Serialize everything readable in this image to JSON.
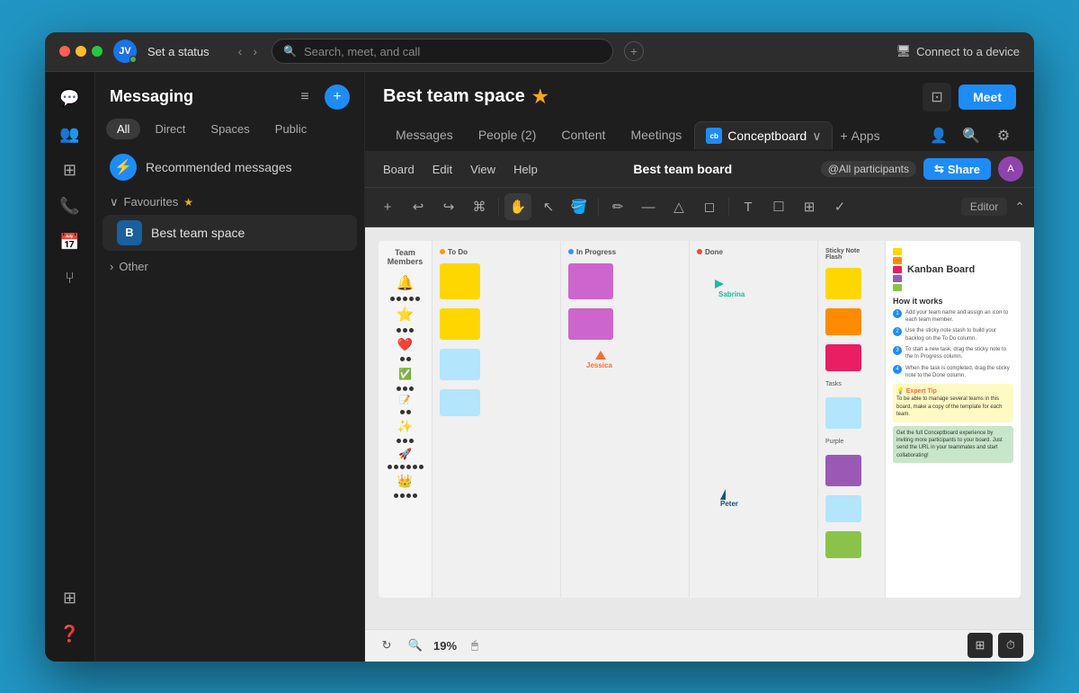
{
  "window": {
    "title": "Best team space"
  },
  "titlebar": {
    "user_initials": "JV",
    "set_status": "Set a status",
    "search_placeholder": "Search, meet, and call",
    "connect_device": "Connect to a device"
  },
  "messaging": {
    "title": "Messaging",
    "filters": [
      "All",
      "Direct",
      "Spaces",
      "Public"
    ],
    "active_filter": "All",
    "recommended_label": "Recommended messages",
    "favourites_label": "Favourites",
    "space_name": "Best team space",
    "space_initial": "B",
    "other_label": "Other"
  },
  "content": {
    "space_title": "Best team space",
    "tabs": [
      "Messages",
      "People (2)",
      "Content",
      "Meetings"
    ],
    "active_tab": "Conceptboard",
    "apps_label": "Apps",
    "meet_label": "Meet"
  },
  "conceptboard": {
    "menu_items": [
      "Board",
      "Edit",
      "View",
      "Help"
    ],
    "board_title": "Best team board",
    "participants_label": "@All participants",
    "share_label": "Share",
    "editor_label": "Editor",
    "zoom_level": "19%",
    "kanban": {
      "title": "Kanban Board",
      "subtitle": "How it works",
      "columns": [
        {
          "label": "Team Members",
          "dot_color": "#333"
        },
        {
          "label": "To Do",
          "dot_color": "#f39c12"
        },
        {
          "label": "In Progress",
          "dot_color": "#3498db"
        },
        {
          "label": "Done",
          "dot_color": "#e74c3c"
        }
      ],
      "cursors": [
        {
          "name": "Jessica",
          "color": "#ff6b35"
        },
        {
          "name": "Peter",
          "color": "#1a5276"
        },
        {
          "name": "Sabrina",
          "color": "#1abc9c"
        }
      ]
    }
  },
  "tools": {
    "draw_tools": [
      "+",
      "↩",
      "↪",
      "⌘",
      "✋",
      "↖",
      "🪣",
      "✏",
      "T",
      "□",
      "⊞",
      "✓"
    ]
  }
}
